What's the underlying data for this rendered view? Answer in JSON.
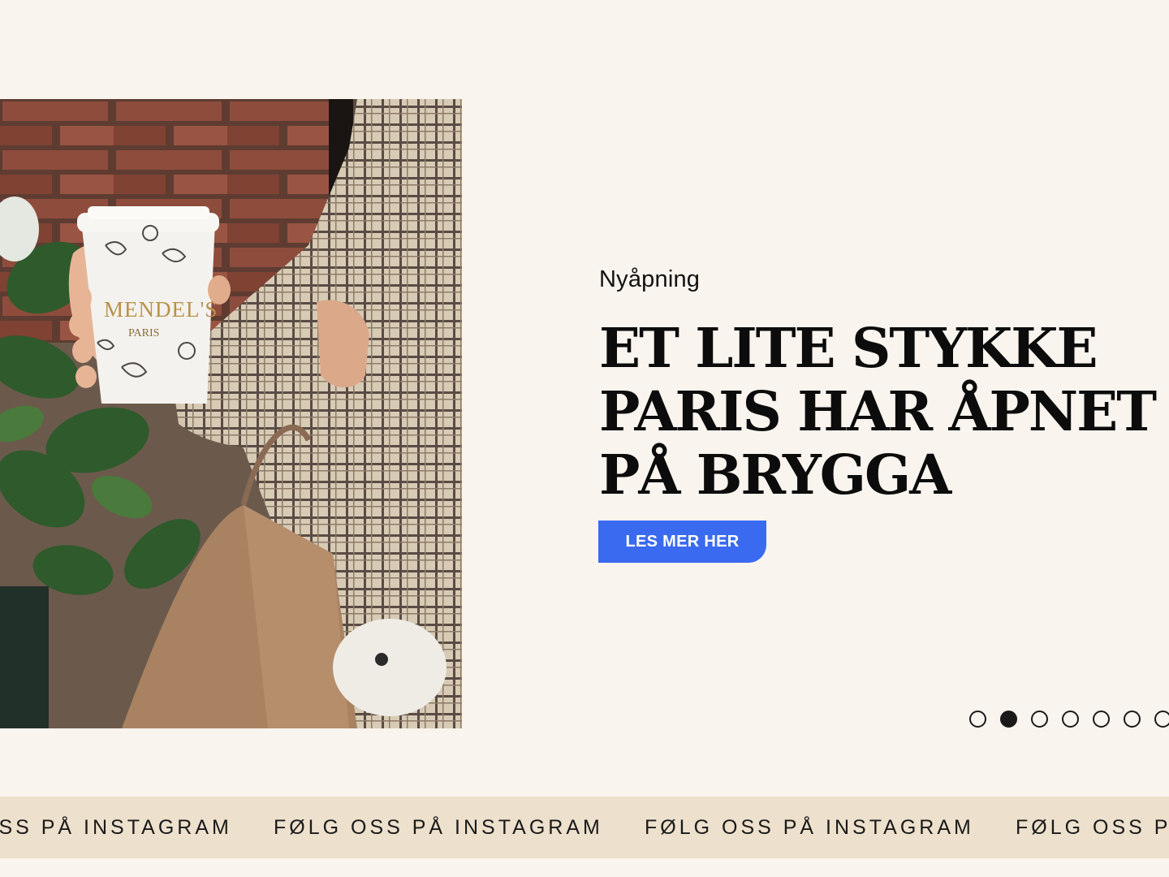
{
  "hero": {
    "photo": {
      "alt": "Hand holding a Mendel's Paris coffee cup",
      "cup_brand": "MENDEL'S",
      "cup_city": "PARIS"
    },
    "eyebrow": "Nyåpning",
    "headline": "ET LITE STYKKE PARIS HAR ÅPNET PÅ BRYGGA",
    "cta_label": "LES MER HER"
  },
  "carousel": {
    "total_slides": 7,
    "active_index": 1
  },
  "marquee": {
    "items": [
      "FØLG OSS PÅ INSTAGRAM",
      "FØLG OSS PÅ INSTAGRAM",
      "FØLG OSS PÅ INSTAGRAM",
      "FØLG OSS PÅ INSTAGRAM"
    ]
  },
  "colors": {
    "background": "#faf4ee",
    "marquee_bg": "#ede0cc",
    "cta": "#3a6af0",
    "text": "#0c0c0c"
  }
}
